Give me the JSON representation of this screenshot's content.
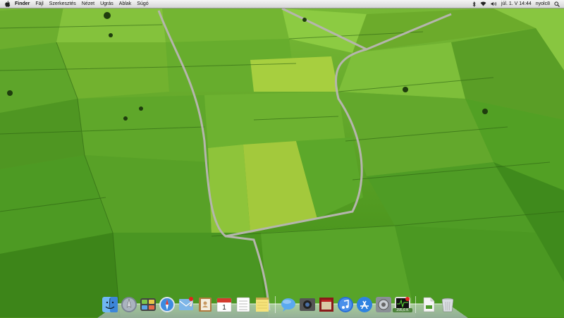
{
  "menubar": {
    "apple_icon": "apple-icon",
    "items": [
      "Finder",
      "Fájl",
      "Szerkesztés",
      "Nézet",
      "Ugrás",
      "Ablak",
      "Súgó"
    ],
    "clock": "júl. 1. V 14:44",
    "user": "nyolc8",
    "extras_icons": [
      "bluetooth-icon",
      "wifi-icon",
      "volume-icon",
      "spotlight-icon"
    ]
  },
  "dock": {
    "items": [
      {
        "icon": "finder-icon"
      },
      {
        "icon": "launchpad-icon"
      },
      {
        "icon": "dashboard-icon"
      },
      {
        "icon": "safari-icon"
      },
      {
        "icon": "mail-icon"
      },
      {
        "icon": "contacts-icon"
      },
      {
        "icon": "calendar-icon",
        "text": "1"
      },
      {
        "icon": "reminders-icon"
      },
      {
        "icon": "notes-icon"
      },
      {
        "icon": "messages-icon"
      },
      {
        "icon": "facetime-icon"
      },
      {
        "icon": "photo-booth-icon"
      },
      {
        "icon": "itunes-icon"
      },
      {
        "icon": "app-store-icon"
      },
      {
        "icon": "system-preferences-icon"
      },
      {
        "icon": "activity-monitor-icon",
        "badge": "295,6 K"
      },
      {
        "icon": "document-icon"
      },
      {
        "icon": "trash-icon"
      }
    ]
  },
  "colors": {
    "field_light": "#8cc63e",
    "field_mid": "#5ea52a",
    "field_dark": "#3a7a1a",
    "road": "#b8b8b0"
  }
}
